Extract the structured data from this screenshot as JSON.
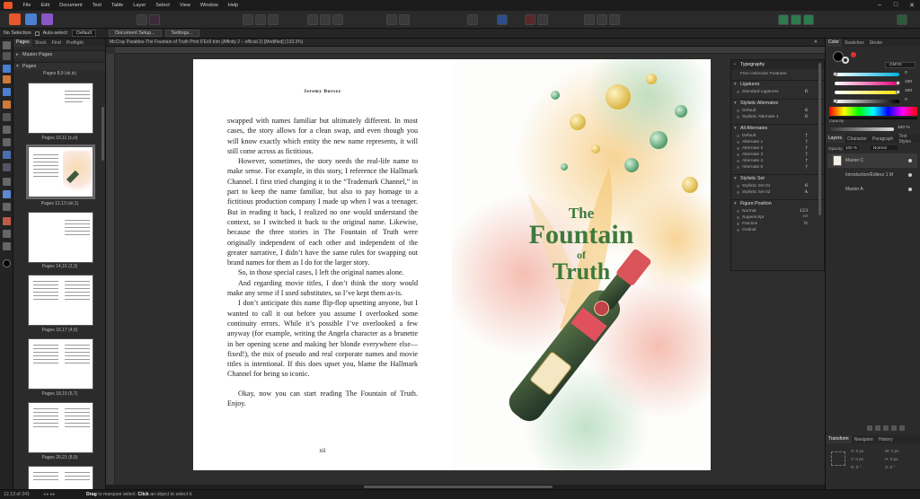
{
  "menu": [
    "File",
    "Edit",
    "Document",
    "Text",
    "Table",
    "Layer",
    "Select",
    "View",
    "Window",
    "Help"
  ],
  "context_bar": {
    "selection": "No Selection",
    "auto_select_label": "Auto-select:",
    "auto_select_value": "Default",
    "document_setup": "Document Setup...",
    "settings": "Settings..."
  },
  "pages_panel": {
    "tabs": [
      "Pages",
      "Stock",
      "Find",
      "Preflight"
    ],
    "master_pages": "Master Pages",
    "pages": "Pages",
    "thumb_labels": [
      "Pages 8,9 (vii,ix)",
      "Pages 10,11 (x,xi)",
      "Pages 12,13 (xii,1)",
      "Pages 14,15 (2,3)",
      "Pages 16,17 (4,5)",
      "Pages 18,19 (6,7)",
      "Pages 20,21 (8,9)"
    ]
  },
  "document_tab": "McCray Parables-The Fountain of Truth Print 6'Ex9 trim (Affinity 2 – official 2) [Modified] (133.3%)",
  "left_page": {
    "running_head": "Jeremy Bursey",
    "paragraphs": [
      "swapped with names familiar but ultimately different. In most cases, the story allows for a clean swap, and even though you will know exactly which entity the new name represents, it will still come across as fictitious.",
      "However, sometimes, the story needs the real-life name to make sense. For example, in this story, I reference the Hallmark Channel. I first tried changing it to the “Trademark Channel,” in part to keep the name familiar, but also to pay homage to a fictitious production company I made up when I was a teenager. But in reading it back, I realized no one would understand the context, so I switched it back to the original name. Likewise, because the three stories in The Fountain of Truth were originally independent of each other and independent of the greater narrative, I didn’t have the same rules for swapping out brand names for them as I do for the larger story.",
      "So, in those special cases, I left the original names alone.",
      "And regarding movie titles, I don’t think the story would make any sense if I used substitutes, so I’ve kept them as-is.",
      "I don’t anticipate this name flip-flop upsetting anyone, but I wanted to call it out before you assume I overlooked some continuity errors. While it’s possible I’ve overlooked a few anyway (for example, writing the Angela character as a brunette in her opening scene and making her blonde everywhere else—fixed!), the mix of pseudo and real corporate names and movie titles is intentional. If this does upset you, blame the Hallmark Channel for being so iconic.",
      "Okay, now you can start reading The Fountain of Truth. Enjoy."
    ],
    "folio": "xii"
  },
  "cover": {
    "the": "The",
    "fountain": "Fountain",
    "of": "of",
    "truth": "Truth",
    "seal": "HO"
  },
  "typography_panel": {
    "title": "Typography",
    "sub": "Free Unknown Features",
    "sections": [
      {
        "title": "Ligatures",
        "rows": [
          {
            "label": "Standard Ligatures",
            "glyph": "fi"
          }
        ]
      },
      {
        "title": "Stylistic Alternates",
        "rows": [
          {
            "label": "Default",
            "glyph": "6"
          },
          {
            "label": "Stylistic Alternate 1",
            "glyph": "6"
          }
        ]
      },
      {
        "title": "All Alternates",
        "rows": [
          {
            "label": "Default",
            "glyph": "†"
          },
          {
            "label": "Alternate 1",
            "glyph": "†"
          },
          {
            "label": "Alternate 2",
            "glyph": "†"
          },
          {
            "label": "Alternate 3",
            "glyph": "†"
          },
          {
            "label": "Alternate 4",
            "glyph": "†"
          },
          {
            "label": "Alternate 5",
            "glyph": "†"
          }
        ]
      },
      {
        "title": "Stylistic Set",
        "rows": [
          {
            "label": "Stylistic Set 01",
            "glyph": "6"
          },
          {
            "label": "Stylistic Set 02",
            "glyph": "A"
          }
        ]
      },
      {
        "title": "Figure Position",
        "rows": [
          {
            "label": "Normal",
            "glyph": "123"
          },
          {
            "label": "Superscript",
            "glyph": "¹²³"
          },
          {
            "label": "Fraction",
            "glyph": "½"
          },
          {
            "label": "Ordinal",
            "glyph": ""
          }
        ]
      }
    ]
  },
  "right_panel": {
    "color_tabs": [
      "Color",
      "Swatches",
      "Stroke"
    ],
    "color_model": "CMYK",
    "values": [
      "0",
      "100",
      "100",
      "0"
    ],
    "opacity_label": "Opacity",
    "opacity_value": "100 %",
    "layer_tabs": [
      "Layers",
      "Character",
      "Paragraph",
      "Text Styles"
    ],
    "layer_opacity": "Opacity:",
    "layer_opacity_value": "100 %",
    "blend": "Normal",
    "layers": [
      "Master C",
      "Introduction/Éditeur 1 M",
      "Master A"
    ],
    "transform_tabs": [
      "Transform",
      "Navigator",
      "History"
    ],
    "transform_fields": [
      "X:",
      "Y:",
      "W:",
      "H:",
      "R:",
      "S:"
    ],
    "transform_values": [
      "0 px",
      "0 px",
      "0 px",
      "0 px",
      "0 °",
      "0 °"
    ]
  },
  "status_bar": {
    "page": "12,13 of 241",
    "hint_1": "Drag",
    "hint_2": " to marquee select. ",
    "hint_3": "Click",
    "hint_4": " an object to select it."
  }
}
